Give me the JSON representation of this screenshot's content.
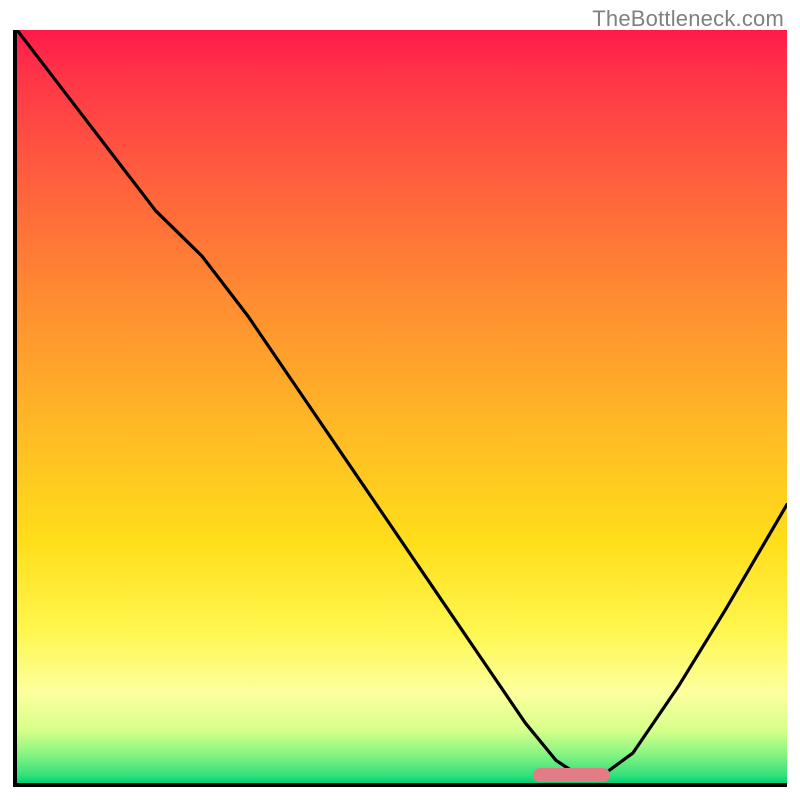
{
  "watermark": "TheBottleneck.com",
  "chart_data": {
    "type": "line",
    "title": "",
    "xlabel": "",
    "ylabel": "",
    "xlim": [
      0,
      100
    ],
    "ylim": [
      0,
      100
    ],
    "grid": false,
    "series": [
      {
        "name": "curve",
        "x": [
          0,
          6,
          12,
          18,
          24,
          30,
          36,
          42,
          48,
          54,
          60,
          66,
          70,
          73,
          76,
          80,
          86,
          92,
          100
        ],
        "y": [
          100,
          92,
          84,
          76,
          70,
          62,
          53,
          44,
          35,
          26,
          17,
          8,
          3,
          1,
          1,
          4,
          13,
          23,
          37
        ]
      }
    ],
    "optimal_marker": {
      "x_start": 67,
      "x_end": 77,
      "y": 0
    },
    "gradient_stops": [
      {
        "pct": 0,
        "color": "#ff1a4b"
      },
      {
        "pct": 35,
        "color": "#ff8a32"
      },
      {
        "pct": 68,
        "color": "#ffde1a"
      },
      {
        "pct": 88,
        "color": "#fdff9e"
      },
      {
        "pct": 100,
        "color": "#00d074"
      }
    ]
  }
}
